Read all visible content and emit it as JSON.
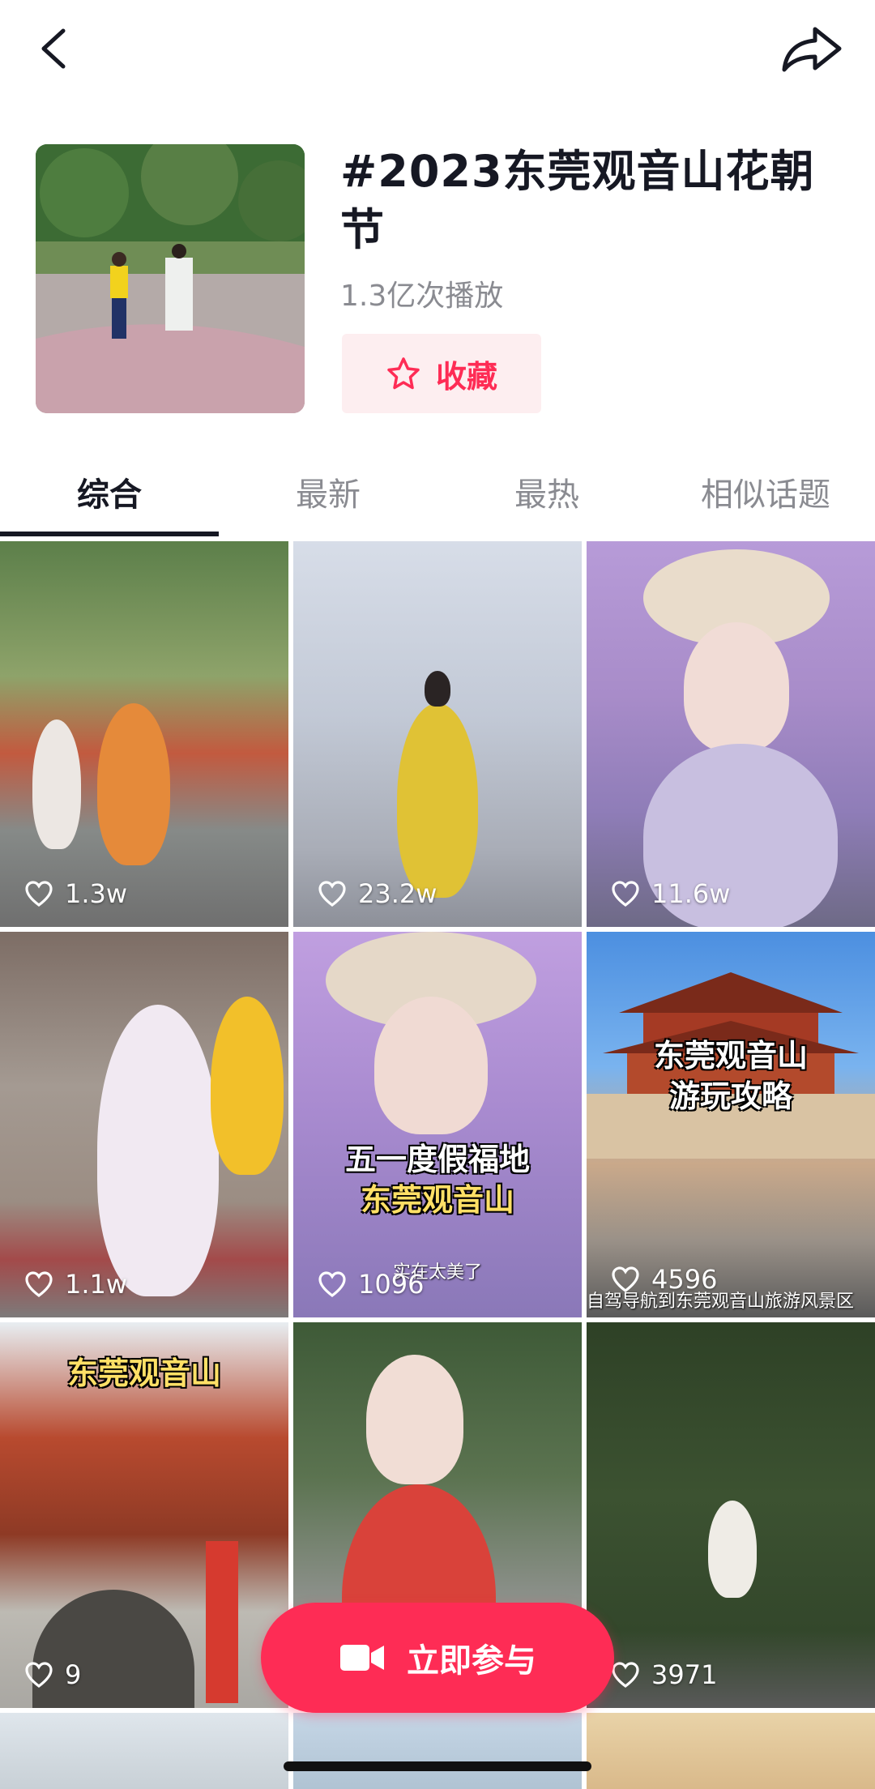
{
  "nav": {
    "back_icon": "chevron-left-icon",
    "share_icon": "share-arrow-icon"
  },
  "topic": {
    "title": "#2023东莞观音山花朝节",
    "plays": "1.3亿次播放",
    "favorite_label": "收藏"
  },
  "tabs": [
    {
      "label": "综合",
      "active": true
    },
    {
      "label": "最新",
      "active": false
    },
    {
      "label": "最热",
      "active": false
    },
    {
      "label": "相似话题",
      "active": false
    }
  ],
  "videos": [
    {
      "likes": "1.3w"
    },
    {
      "likes": "23.2w"
    },
    {
      "likes": "11.6w"
    },
    {
      "likes": "1.1w"
    },
    {
      "likes": "1096",
      "overlay_line1": "五一度假福地",
      "overlay_line2": "东莞观音山",
      "caption": "实在太美了"
    },
    {
      "likes": "4596",
      "overlay_line1": "东莞观音山",
      "overlay_line2": "游玩攻略",
      "caption": "自驾导航到东莞观音山旅游风景区"
    },
    {
      "likes": "9",
      "overlay_line1": "东莞观音山"
    },
    {
      "likes": ""
    },
    {
      "likes": "3971"
    }
  ],
  "join_button": {
    "label": "立即参与",
    "icon": "video-camera-icon"
  },
  "colors": {
    "accent": "#fe2c55",
    "favorite_bg": "#fdeef0",
    "text_primary": "#161823",
    "text_secondary": "#8a8b91"
  }
}
